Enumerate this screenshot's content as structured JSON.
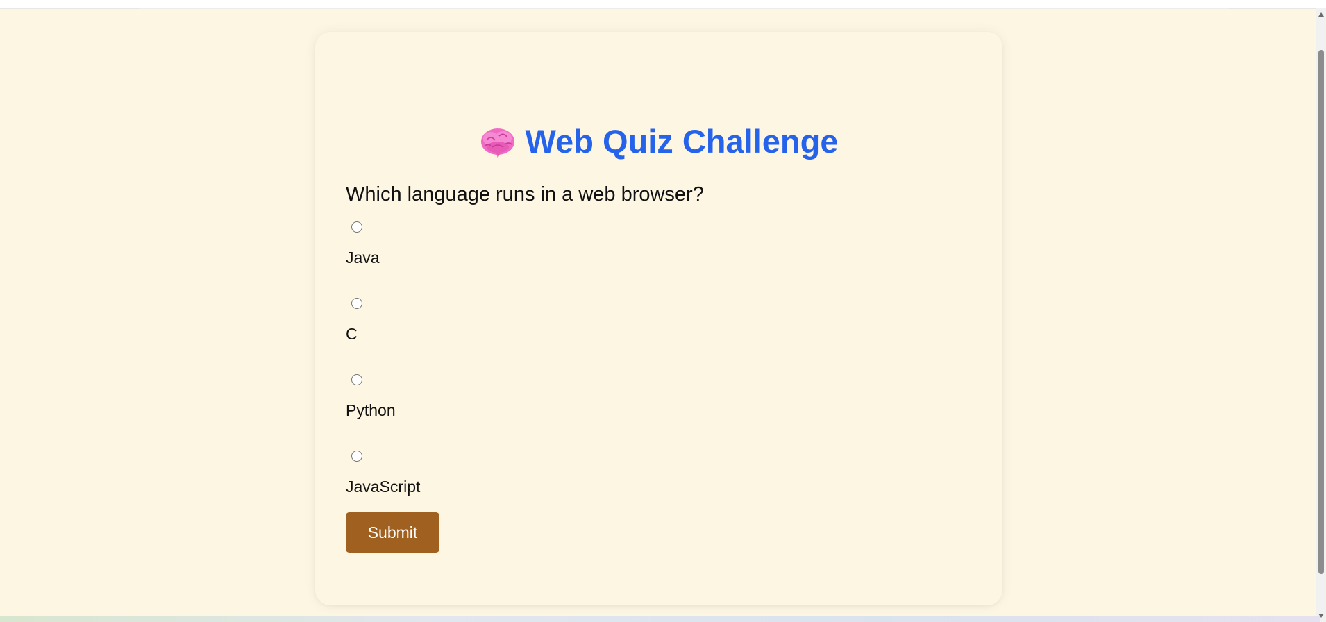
{
  "quiz": {
    "title": "Web Quiz Challenge",
    "title_icon": "brain-icon",
    "question": "Which language runs in a web browser?",
    "options": [
      {
        "label": "Java"
      },
      {
        "label": "C"
      },
      {
        "label": "Python"
      },
      {
        "label": "JavaScript"
      }
    ],
    "submit_label": "Submit"
  },
  "colors": {
    "background": "#fdf6e3",
    "title": "#2563eb",
    "submit_button": "#a0601f"
  }
}
